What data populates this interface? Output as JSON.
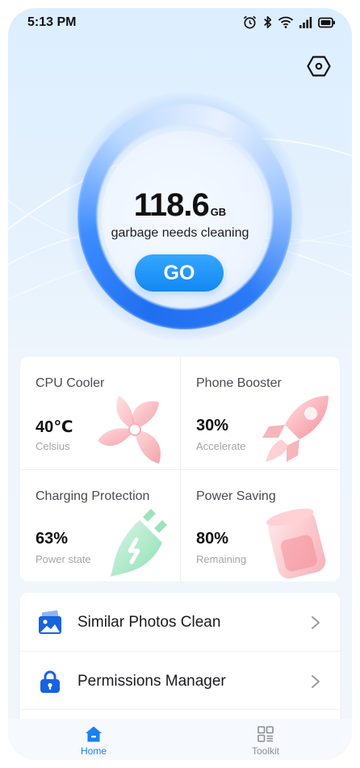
{
  "status_bar": {
    "time": "5:13 PM",
    "icons": [
      "alarm-icon",
      "bluetooth-icon",
      "wifi-icon",
      "signal-icon",
      "battery-icon"
    ]
  },
  "header": {
    "settings_icon": "hexagon-settings-icon"
  },
  "cleaner": {
    "value": "118.6",
    "unit": "GB",
    "caption": "garbage needs cleaning",
    "button_label": "GO"
  },
  "features": [
    {
      "title": "CPU Cooler",
      "value": "40℃",
      "subtitle": "Celsius",
      "icon": "fan-icon"
    },
    {
      "title": "Phone Booster",
      "value": "30%",
      "subtitle": "Accelerate",
      "icon": "rocket-icon"
    },
    {
      "title": "Charging Protection",
      "value": "63%",
      "subtitle": "Power state",
      "icon": "charger-plug-icon"
    },
    {
      "title": "Power Saving",
      "value": "80%",
      "subtitle": "Remaining",
      "icon": "battery-cup-icon"
    }
  ],
  "tools": [
    {
      "label": "Similar Photos Clean",
      "icon": "photos-icon"
    },
    {
      "label": "Permissions Manager",
      "icon": "lock-icon"
    }
  ],
  "bottom_nav": {
    "items": [
      {
        "label": "Home",
        "icon": "home-icon",
        "active": true
      },
      {
        "label": "Toolkit",
        "icon": "grid-icon",
        "active": false
      }
    ]
  },
  "colors": {
    "accent": "#1a7ff0",
    "go_button": "#1288f3",
    "text_primary": "#111111",
    "text_secondary": "#a4a4ab"
  }
}
